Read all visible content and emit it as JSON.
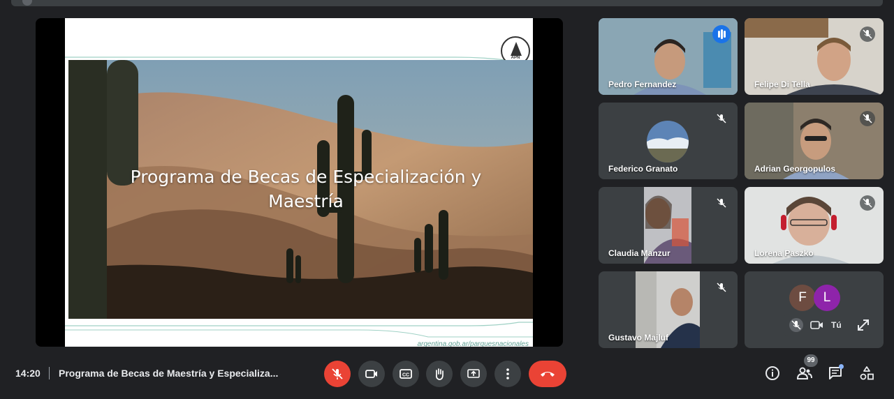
{
  "colors": {
    "background": "#202124",
    "tile": "#3c4043",
    "danger": "#ea4335",
    "speaking_outline": "#8ab4f8",
    "active_blue": "#1a73e8"
  },
  "presentation": {
    "title": "Programa de Becas de Especialización y Maestría",
    "logo_text": "APN",
    "footer_url": "argentina.gob.ar/parquesnacionales"
  },
  "participants": [
    {
      "name": "Pedro Fernandez",
      "status_icon": "speaking-indicator-icon",
      "speaking": true
    },
    {
      "name": "Felipe Di Tella",
      "status_icon": "mic-off-icon",
      "speaking": false
    },
    {
      "name": "Federico Granato",
      "status_icon": "mic-off-icon",
      "speaking": false
    },
    {
      "name": "Adrian Georgopulos",
      "status_icon": "mic-off-icon",
      "speaking": false
    },
    {
      "name": "Claudia Manzur",
      "status_icon": "mic-off-icon",
      "speaking": false
    },
    {
      "name": "Lorena Paszko",
      "status_icon": "mic-off-icon",
      "speaking": false
    },
    {
      "name": "Gustavo Majluf",
      "status_icon": "mic-off-icon",
      "speaking": false
    }
  ],
  "self_tile": {
    "avatars": [
      {
        "initial": "F",
        "color": "#6d4c41"
      },
      {
        "initial": "L",
        "color": "#8e24aa"
      }
    ],
    "you_label": "Tú"
  },
  "bottom_bar": {
    "time": "14:20",
    "meeting_title": "Programa de Becas de Maestría y Especializa...",
    "controls": [
      "mic-off-icon",
      "camera-icon",
      "captions-icon",
      "raise-hand-icon",
      "present-screen-icon",
      "more-options-icon",
      "leave-call-icon"
    ],
    "side_controls": [
      "info-icon",
      "people-icon",
      "chat-icon",
      "activities-icon"
    ],
    "people_count": "99"
  }
}
